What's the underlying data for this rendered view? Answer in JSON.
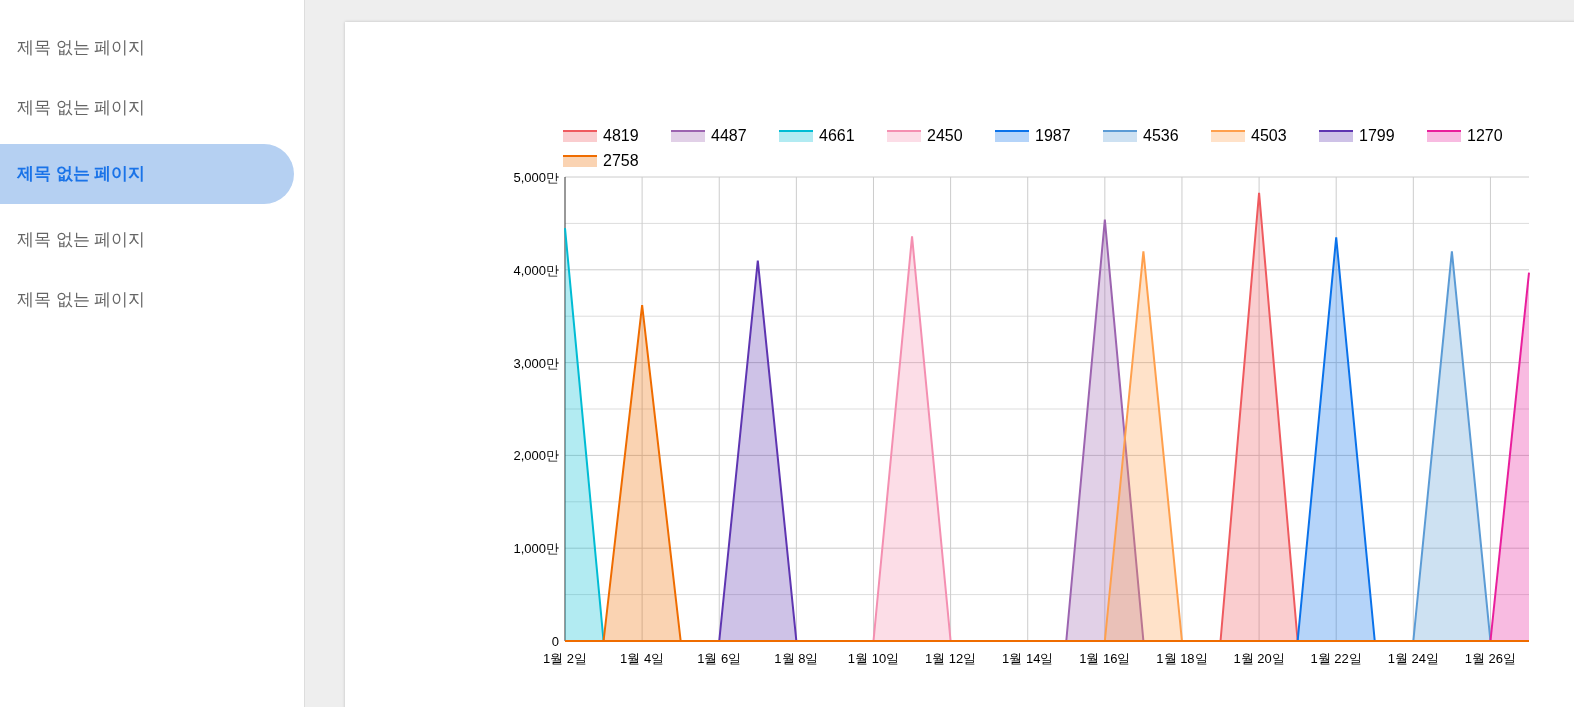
{
  "sidebar": {
    "items": [
      {
        "label": "제목 없는 페이지",
        "selected": false
      },
      {
        "label": "제목 없는 페이지",
        "selected": false
      },
      {
        "label": "제목 없는 페이지",
        "selected": true
      },
      {
        "label": "제목 없는 페이지",
        "selected": false
      },
      {
        "label": "제목 없는 페이지",
        "selected": false
      }
    ]
  },
  "chart": {
    "chart_data": {
      "type": "area",
      "categories": [
        "1월 2일",
        null,
        "1월 4일",
        null,
        "1월 6일",
        null,
        "1월 8일",
        null,
        "1월 10일",
        null,
        "1월 12일",
        null,
        "1월 14일",
        null,
        "1월 16일",
        null,
        "1월 18일",
        null,
        "1월 20일",
        null,
        "1월 22일",
        null,
        "1월 24일",
        null,
        "1월 26일",
        null
      ],
      "ylim": [
        0,
        5000
      ],
      "grid": true,
      "legend": "top",
      "yticks": [
        {
          "value": 0,
          "label": "0"
        },
        {
          "value": 1000,
          "label": "1,000만"
        },
        {
          "value": 2000,
          "label": "2,000만"
        },
        {
          "value": 3000,
          "label": "3,000만"
        },
        {
          "value": 4000,
          "label": "4,000만"
        },
        {
          "value": 5000,
          "label": "5,000만"
        }
      ],
      "series": [
        {
          "name": "4819",
          "color": "#ef5a5f",
          "values": [
            null,
            null,
            null,
            null,
            null,
            null,
            null,
            null,
            null,
            null,
            null,
            null,
            null,
            null,
            null,
            null,
            null,
            0,
            4830,
            0,
            null,
            null,
            null,
            null,
            null,
            null
          ]
        },
        {
          "name": "4487",
          "color": "#9c64b0",
          "values": [
            null,
            null,
            null,
            null,
            null,
            null,
            null,
            null,
            null,
            null,
            null,
            null,
            null,
            0,
            4540,
            0,
            null,
            null,
            null,
            null,
            null,
            null,
            null,
            null,
            null,
            null
          ]
        },
        {
          "name": "4661",
          "color": "#00bcd4",
          "values": [
            4450,
            0,
            null,
            null,
            null,
            null,
            null,
            null,
            null,
            null,
            null,
            null,
            null,
            null,
            null,
            null,
            null,
            null,
            null,
            null,
            null,
            null,
            null,
            null,
            null,
            null
          ]
        },
        {
          "name": "2450",
          "color": "#f48fb1",
          "values": [
            null,
            null,
            null,
            null,
            null,
            null,
            null,
            null,
            0,
            4360,
            0,
            null,
            null,
            null,
            null,
            null,
            null,
            null,
            null,
            null,
            null,
            null,
            null,
            null,
            null,
            null
          ]
        },
        {
          "name": "1987",
          "color": "#0a72ea",
          "values": [
            null,
            null,
            null,
            null,
            null,
            null,
            null,
            null,
            null,
            null,
            null,
            null,
            null,
            null,
            null,
            null,
            null,
            null,
            null,
            0,
            4350,
            0,
            null,
            null,
            null,
            null
          ]
        },
        {
          "name": "4536",
          "color": "#5b9bd5",
          "values": [
            null,
            null,
            null,
            null,
            null,
            null,
            null,
            null,
            null,
            null,
            null,
            null,
            null,
            null,
            null,
            null,
            null,
            null,
            null,
            null,
            null,
            null,
            0,
            4200,
            0,
            null
          ]
        },
        {
          "name": "4503",
          "color": "#ffa04d",
          "values": [
            null,
            null,
            null,
            null,
            null,
            null,
            null,
            null,
            null,
            null,
            null,
            null,
            null,
            null,
            0,
            4200,
            0,
            null,
            null,
            null,
            null,
            null,
            null,
            null,
            null,
            null
          ]
        },
        {
          "name": "1799",
          "color": "#5e35b1",
          "values": [
            null,
            null,
            null,
            null,
            0,
            4100,
            0,
            null,
            null,
            null,
            null,
            null,
            null,
            null,
            null,
            null,
            null,
            null,
            null,
            null,
            null,
            null,
            null,
            null,
            null,
            null
          ]
        },
        {
          "name": "1270",
          "color": "#e91e9c",
          "values": [
            null,
            null,
            null,
            null,
            null,
            null,
            null,
            null,
            null,
            null,
            null,
            null,
            null,
            null,
            null,
            null,
            null,
            null,
            null,
            null,
            null,
            null,
            null,
            null,
            0,
            3970
          ]
        },
        {
          "name": "2758",
          "color": "#ef6c00",
          "values": [
            null,
            0,
            3620,
            0,
            null,
            null,
            null,
            null,
            null,
            null,
            null,
            null,
            null,
            null,
            null,
            null,
            null,
            null,
            null,
            null,
            null,
            null,
            null,
            null,
            null,
            null
          ]
        }
      ]
    }
  }
}
